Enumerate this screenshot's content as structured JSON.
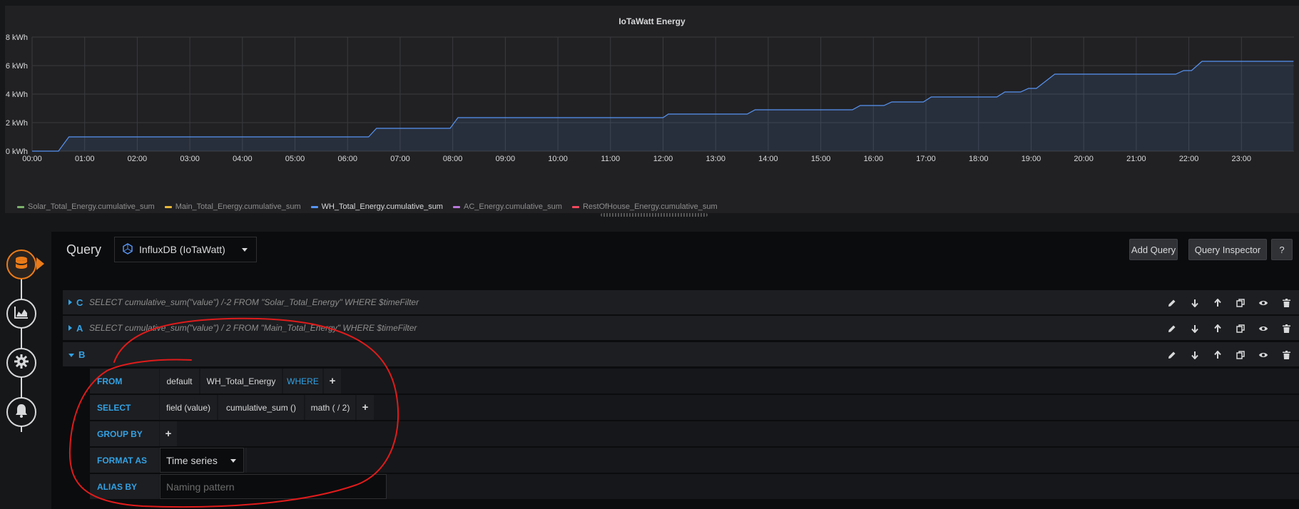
{
  "panel": {
    "title": "IoTaWatt Energy"
  },
  "chart_data": {
    "type": "area",
    "title": "IoTaWatt Energy",
    "ytick_labels": [
      "8 kWh",
      "6 kWh",
      "4 kWh",
      "2 kWh",
      "0 kWh"
    ],
    "ylim": [
      0,
      8
    ],
    "xtick_labels": [
      "00:00",
      "01:00",
      "02:00",
      "03:00",
      "04:00",
      "05:00",
      "06:00",
      "07:00",
      "08:00",
      "09:00",
      "10:00",
      "11:00",
      "12:00",
      "13:00",
      "14:00",
      "15:00",
      "16:00",
      "17:00",
      "18:00",
      "19:00",
      "20:00",
      "21:00",
      "22:00",
      "23:00"
    ],
    "xlim_hours": [
      0,
      24
    ],
    "grid": true,
    "legend_placement": "bottom-left",
    "series": [
      {
        "name": "Solar_Total_Energy.cumulative_sum",
        "color": "#7eb26d",
        "points": []
      },
      {
        "name": "Main_Total_Energy.cumulative_sum",
        "color": "#eab839",
        "points": []
      },
      {
        "name": "WH_Total_Energy.cumulative_sum",
        "color": "#5794f2",
        "points": [
          [
            0,
            0
          ],
          [
            0.5,
            0
          ],
          [
            0.7,
            1.0
          ],
          [
            6.4,
            1.0
          ],
          [
            6.55,
            1.6
          ],
          [
            7.95,
            1.6
          ],
          [
            8.1,
            2.35
          ],
          [
            12.0,
            2.35
          ],
          [
            12.1,
            2.6
          ],
          [
            13.6,
            2.6
          ],
          [
            13.75,
            2.9
          ],
          [
            15.6,
            2.9
          ],
          [
            15.75,
            3.2
          ],
          [
            16.2,
            3.2
          ],
          [
            16.35,
            3.45
          ],
          [
            16.95,
            3.45
          ],
          [
            17.1,
            3.8
          ],
          [
            18.35,
            3.8
          ],
          [
            18.5,
            4.15
          ],
          [
            18.8,
            4.15
          ],
          [
            18.95,
            4.4
          ],
          [
            19.1,
            4.4
          ],
          [
            19.45,
            5.4
          ],
          [
            21.75,
            5.4
          ],
          [
            21.9,
            5.65
          ],
          [
            22.05,
            5.65
          ],
          [
            22.25,
            6.3
          ],
          [
            23.99,
            6.3
          ]
        ]
      },
      {
        "name": "AC_Energy.cumulative_sum",
        "color": "#b877d9",
        "points": []
      },
      {
        "name": "RestOfHouse_Energy.cumulative_sum",
        "color": "#f2495c",
        "points": []
      }
    ]
  },
  "legend": [
    {
      "label": "Solar_Total_Energy.cumulative_sum",
      "color": "#7eb26d"
    },
    {
      "label": "Main_Total_Energy.cumulative_sum",
      "color": "#eab839"
    },
    {
      "label": "WH_Total_Energy.cumulative_sum",
      "color": "#5794f2"
    },
    {
      "label": "AC_Energy.cumulative_sum",
      "color": "#b877d9"
    },
    {
      "label": "RestOfHouse_Energy.cumulative_sum",
      "color": "#f2495c"
    }
  ],
  "side_nav": {
    "items": [
      {
        "icon": "database-icon",
        "active": true
      },
      {
        "icon": "area-chart-icon",
        "active": false
      },
      {
        "icon": "gear-icon",
        "active": false
      },
      {
        "icon": "bell-icon",
        "active": false
      }
    ]
  },
  "query_header": {
    "label": "Query",
    "datasource": "InfluxDB (IoTaWatt)",
    "add_query": "Add Query",
    "query_inspector": "Query Inspector",
    "help": "?"
  },
  "queries": [
    {
      "letter": "C",
      "text": "SELECT cumulative_sum(\"value\") /-2 FROM \"Solar_Total_Energy\" WHERE $timeFilter",
      "expanded": false
    },
    {
      "letter": "A",
      "text": "SELECT cumulative_sum(\"value\") / 2 FROM \"Main_Total_Energy\" WHERE $timeFilter",
      "expanded": false
    },
    {
      "letter": "B",
      "text": "",
      "expanded": true
    }
  ],
  "editor": {
    "from": {
      "label": "FROM",
      "policy": "default",
      "measurement": "WH_Total_Energy",
      "where": "WHERE",
      "plus": "+"
    },
    "select": {
      "label": "SELECT",
      "field": "field (value)",
      "fn": "cumulative_sum ()",
      "math": "math ( / 2)",
      "plus": "+"
    },
    "group_by": {
      "label": "GROUP BY",
      "plus": "+"
    },
    "format_as": {
      "label": "FORMAT AS",
      "value": "Time series"
    },
    "alias_by": {
      "label": "ALIAS BY",
      "placeholder": "Naming pattern"
    }
  },
  "colors": {
    "accent_blue": "#33a2e5",
    "active_orange": "#eb7b18",
    "annotation_red": "#e01b1b"
  }
}
